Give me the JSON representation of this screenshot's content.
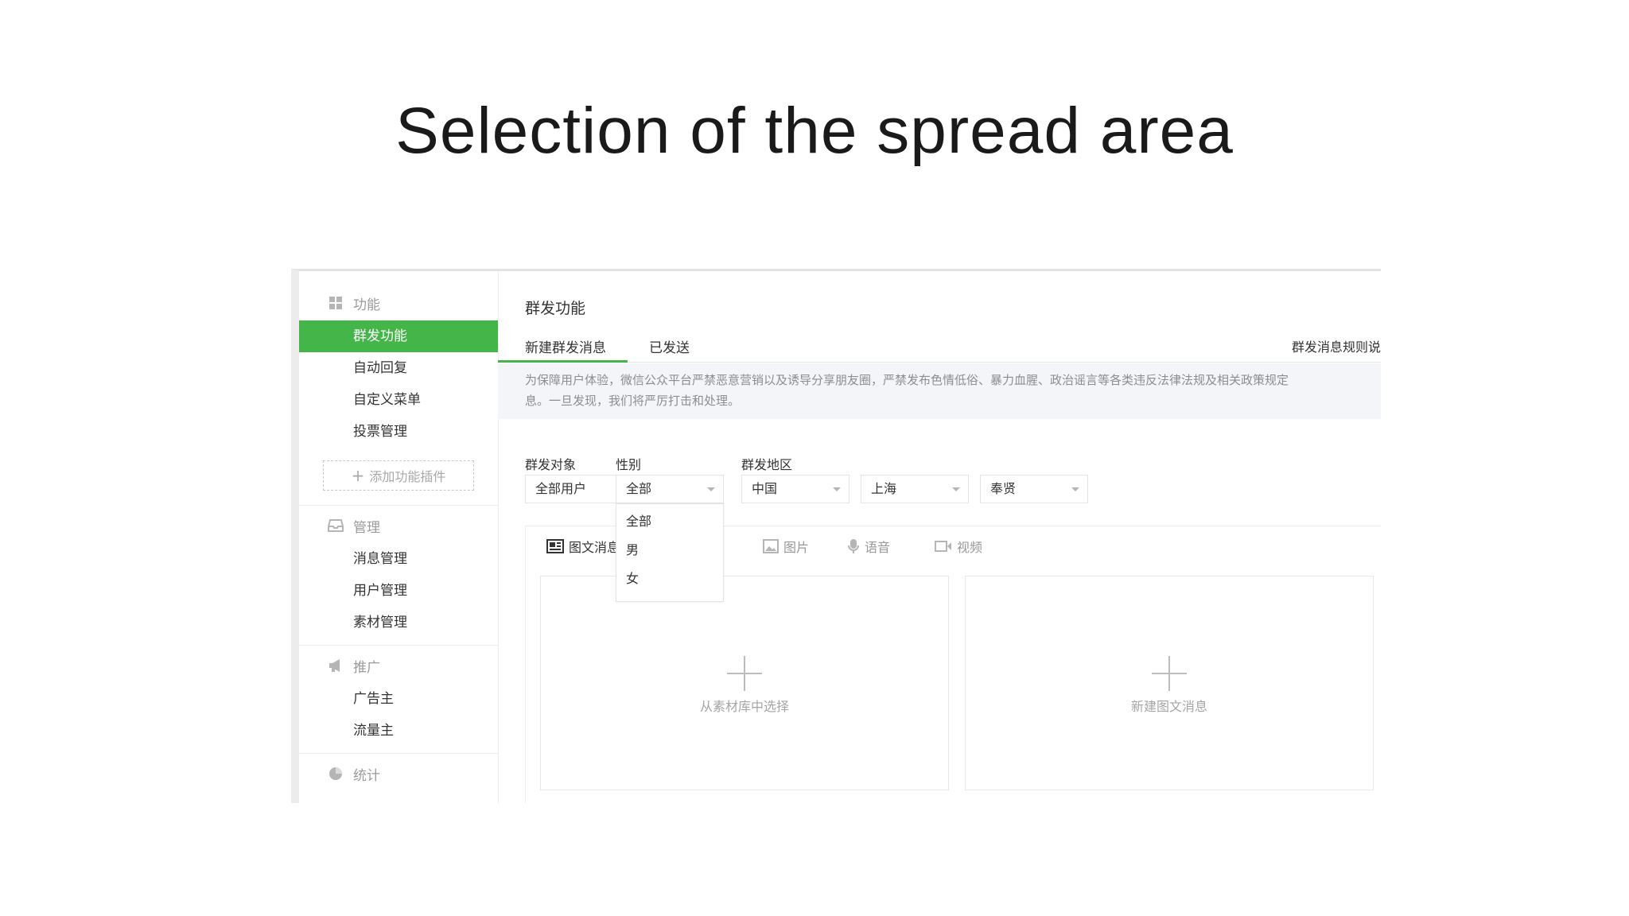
{
  "slide": {
    "title": "Selection of the spread area"
  },
  "sidebar": {
    "sections": [
      {
        "label": "功能",
        "icon": "grid-icon",
        "items": [
          "群发功能",
          "自动回复",
          "自定义菜单",
          "投票管理"
        ]
      },
      {
        "label": "管理",
        "icon": "inbox-icon",
        "items": [
          "消息管理",
          "用户管理",
          "素材管理"
        ]
      },
      {
        "label": "推广",
        "icon": "megaphone-icon",
        "items": [
          "广告主",
          "流量主"
        ]
      },
      {
        "label": "统计",
        "icon": "pie-chart-icon",
        "items": []
      }
    ],
    "active_item": "群发功能",
    "add_plugin_label": "添加功能插件"
  },
  "main": {
    "title": "群发功能",
    "tabs": [
      {
        "label": "新建群发消息",
        "active": true
      },
      {
        "label": "已发送",
        "active": false
      }
    ],
    "rules_link": "群发消息规则说",
    "notice_line1": "为保障用户体验，微信公众平台严禁恶意营销以及诱导分享朋友圈，严禁发布色情低俗、暴力血腥、政治谣言等各类违反法律法规及相关政策规定",
    "notice_line2": "息。一旦发现，我们将严厉打击和处理。",
    "filters": {
      "target_label": "群发对象",
      "target_value": "全部用户",
      "gender_label": "性别",
      "gender_value": "全部",
      "region_label": "群发地区",
      "country_value": "中国",
      "province_value": "上海",
      "city_value": "奉贤"
    },
    "gender_options": [
      "全部",
      "男",
      "女"
    ],
    "message_types": [
      {
        "label": "图文消息",
        "icon": "news-icon",
        "selected": true
      },
      {
        "label": "图片",
        "icon": "image-icon",
        "selected": false
      },
      {
        "label": "语音",
        "icon": "microphone-icon",
        "selected": false
      },
      {
        "label": "视频",
        "icon": "video-icon",
        "selected": false
      }
    ],
    "cards": [
      {
        "label": "从素材库中选择"
      },
      {
        "label": "新建图文消息"
      }
    ],
    "accent_color": "#44b549"
  }
}
